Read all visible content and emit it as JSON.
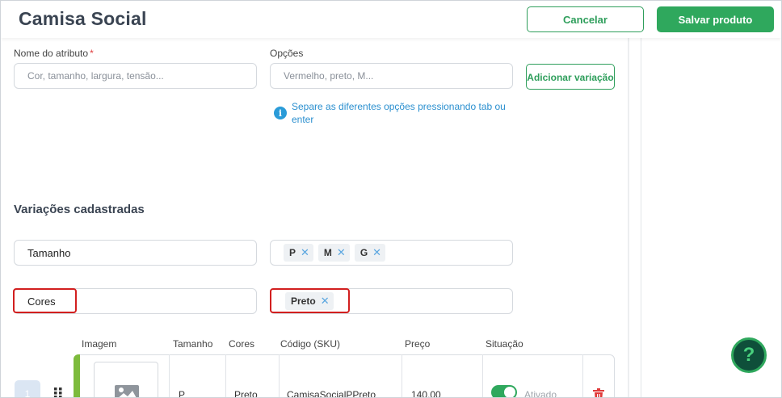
{
  "header": {
    "title": "Camisa Social",
    "cancel_label": "Cancelar",
    "save_label": "Salvar produto"
  },
  "attribute_form": {
    "name_label": "Nome do atributo",
    "required_mark": "*",
    "name_placeholder": "Cor, tamanho, largura, tensão...",
    "options_label": "Opções",
    "options_placeholder": "Vermelho, preto, M...",
    "add_variation_label": "Adicionar variação",
    "hint_icon": "i",
    "hint_text": "Separe as diferentes opções pressionando tab ou enter"
  },
  "variations": {
    "title": "Variações cadastradas",
    "rows": [
      {
        "attribute": "Tamanho",
        "options": [
          "P",
          "M",
          "G"
        ]
      },
      {
        "attribute": "Cores",
        "options": [
          "Preto"
        ]
      }
    ],
    "chip_remove_glyph": "✕"
  },
  "table": {
    "headers": [
      "Imagem",
      "Tamanho",
      "Cores",
      "Código (SKU)",
      "Preço",
      "Situação"
    ],
    "rows": [
      {
        "index": "1",
        "size": "P",
        "color": "Preto",
        "sku": "CamisaSocialPPreto",
        "price": "140.00",
        "status": "Ativado",
        "active": true
      }
    ]
  },
  "help_button": {
    "label": "?"
  },
  "colors": {
    "accent_green": "#2fa85d",
    "highlight_red": "#d21f1f",
    "hint_blue": "#2a8fcf",
    "delete_red": "#e03a3a"
  },
  "icons": [
    "info-icon",
    "close-icon",
    "image-placeholder-icon",
    "drag-handle-icon",
    "trash-icon",
    "help-icon"
  ]
}
